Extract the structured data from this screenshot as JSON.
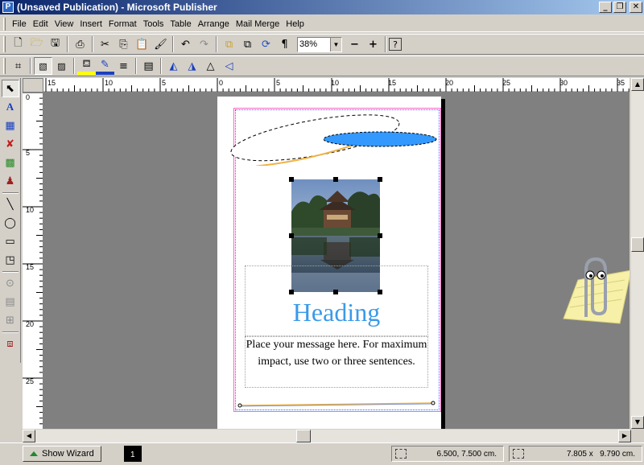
{
  "window": {
    "title": "(Unsaved Publication) - Microsoft Publisher",
    "app_icon": "publisher-icon",
    "controls": [
      "_",
      "❐",
      "✕"
    ]
  },
  "menu": [
    "File",
    "Edit",
    "View",
    "Insert",
    "Format",
    "Tools",
    "Table",
    "Arrange",
    "Mail Merge",
    "Help"
  ],
  "standard_toolbar": {
    "buttons": [
      "new-icon",
      "open-icon",
      "save-icon",
      "print-icon",
      "cut-icon",
      "copy-icon",
      "paste-icon",
      "format-painter-icon",
      "undo-icon",
      "redo-icon",
      "bring-front-icon",
      "send-back-icon",
      "rotate-icon",
      "show-special-chars-icon"
    ],
    "zoom": "38%",
    "zoom_out": "−",
    "zoom_in": "+",
    "help": "?"
  },
  "formatting_toolbar": {
    "buttons": [
      "crop-icon",
      "border-icon",
      "shadow-icon",
      "fill-color-icon",
      "line-color-icon",
      "line-style-icon",
      "object-properties-icon",
      "rotate-left-icon",
      "rotate-right-icon",
      "flip-vertical-icon",
      "flip-horizontal-icon"
    ]
  },
  "toolbox": [
    "pointer-icon",
    "text-frame-icon",
    "table-frame-icon",
    "wordart-icon",
    "picture-frame-icon",
    "clip-gallery-icon",
    "line-icon",
    "oval-icon",
    "rectangle-icon",
    "custom-shapes-icon",
    "hotspot-icon",
    "form-control-icon",
    "html-code-icon",
    "design-gallery-icon"
  ],
  "rulers": {
    "horizontal": [
      "15",
      "10",
      "5",
      "0",
      "5",
      "10",
      "15",
      "20",
      "25",
      "30",
      "35"
    ],
    "vertical": [
      "0",
      "5",
      "10",
      "15",
      "20",
      "25"
    ]
  },
  "page": {
    "heading": "Heading",
    "message": "Place your message here. For maximum impact, use two or three sentences.",
    "photo": "pagoda-pond-photo",
    "heading_color": "#3b9ae8"
  },
  "status": {
    "show_wizard": "Show Wizard",
    "page_number": "1",
    "position": "6.500, 7.500 cm.",
    "size": "7.805 x   9.790 cm."
  },
  "assistant": "office-assistant-clippy"
}
